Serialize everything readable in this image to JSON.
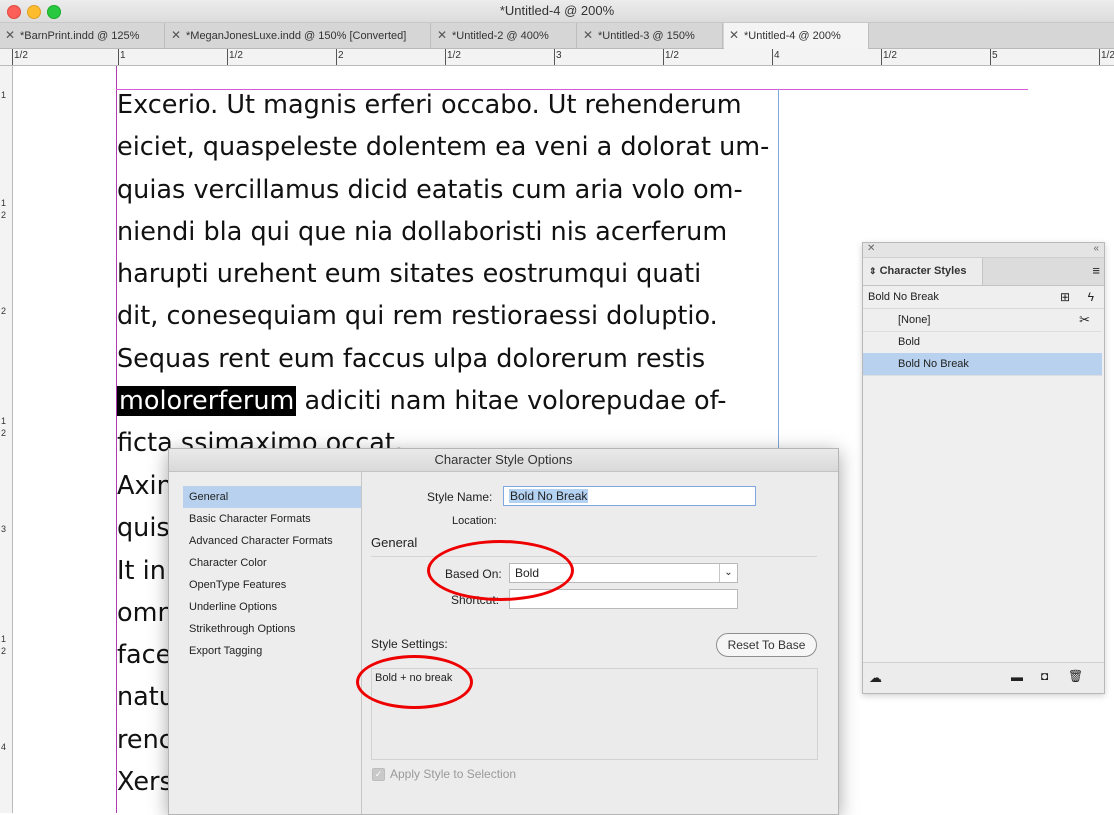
{
  "window": {
    "title": "*Untitled-4 @ 200%"
  },
  "tabs": [
    {
      "label": "*BarnPrint.indd @ 125%",
      "active": false
    },
    {
      "label": "*MeganJonesLuxe.indd @ 150% [Converted]",
      "active": false
    },
    {
      "label": "*Untitled-2 @ 400%",
      "active": false
    },
    {
      "label": "*Untitled-3 @ 150%",
      "active": false
    },
    {
      "label": "*Untitled-4 @ 200%",
      "active": true
    }
  ],
  "ruler": {
    "h_labels": [
      "1/2",
      "1",
      "1/2",
      "2",
      "1/2",
      "3",
      "1/2",
      "4",
      "1/2",
      "5",
      "1/2"
    ],
    "v_labels": [
      "1",
      "1",
      "2",
      "2",
      "3",
      "1",
      "2",
      "1",
      "2",
      "4"
    ]
  },
  "document": {
    "lines": [
      "Excerio. Ut magnis erferi occabo. Ut rehenderum",
      "eiciet, quaspeleste dolentem ea veni a dolorat um-",
      "quias vercillamus dicid eatatis cum aria volo om-",
      "niendi bla qui que nia dollaboristi nis acerferum",
      "harupti urehent eum sitates eostrumqui quati",
      "dit, conesequiam qui rem restioraessi doluptio.",
      "Sequas rent eum faccus ulpa dolorerum restis"
    ],
    "highlight_word": "molorerferum",
    "highlight_rest": " adiciti nam hitae volorepudae of-",
    "line_9": "ficta ssimaximo occat.",
    "partial_lines": [
      "Axin",
      "quis",
      "It in",
      "omn",
      "face",
      "natu",
      "renc",
      "Xers"
    ]
  },
  "panel": {
    "title": "Character Styles",
    "current_style": "Bold No Break",
    "items": [
      {
        "label": "[None]",
        "selected": false
      },
      {
        "label": "Bold",
        "selected": false
      },
      {
        "label": "Bold No Break",
        "selected": true
      }
    ],
    "icons": [
      "close-icon",
      "collapse-icon",
      "panel-menu-icon",
      "new-style-icon",
      "clear-overrides-icon",
      "remove-style-icon",
      "cc-libraries-icon",
      "folder-icon",
      "new-item-icon",
      "trash-icon"
    ]
  },
  "dialog": {
    "title": "Character Style Options",
    "nav": [
      "General",
      "Basic Character Formats",
      "Advanced Character Formats",
      "Character Color",
      "OpenType Features",
      "Underline Options",
      "Strikethrough Options",
      "Export Tagging"
    ],
    "selected_nav": "General",
    "style_name_label": "Style Name:",
    "style_name_value": "Bold No Break",
    "location_label": "Location:",
    "section_title": "General",
    "based_on_label": "Based On:",
    "based_on_value": "Bold",
    "shortcut_label": "Shortcut:",
    "shortcut_value": "",
    "style_settings_label": "Style Settings:",
    "reset_button": "Reset To Base",
    "settings_text": "Bold + no break",
    "apply_label": "Apply Style to Selection",
    "apply_checked": true
  },
  "colors": {
    "annotation_circle": "#e00000",
    "selection": "#b7d1ee",
    "frame_guide": "#b03bb0"
  }
}
